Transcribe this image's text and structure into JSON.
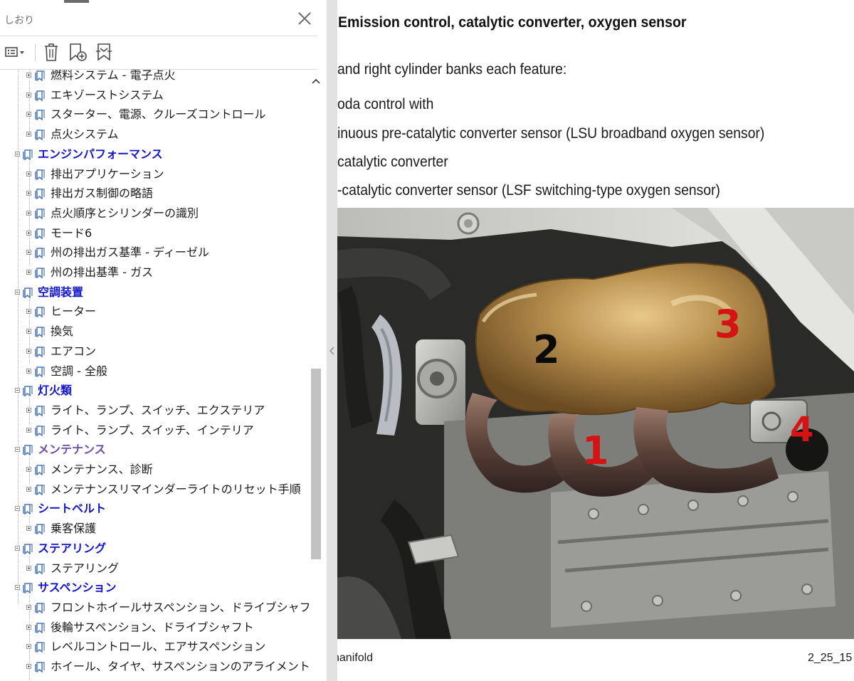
{
  "panel": {
    "title": "しおり",
    "close_icon": "close-icon",
    "toolbar": [
      {
        "name": "options-menu",
        "icon": "list-options-icon"
      },
      {
        "name": "delete-bookmark",
        "icon": "trash-icon"
      },
      {
        "name": "new-bookmark",
        "icon": "add-bookmark-icon"
      },
      {
        "name": "expand-bookmark",
        "icon": "expand-bookmark-icon"
      }
    ]
  },
  "bookmarks": [
    {
      "label": "燃料システム - 電子点火",
      "level": 2
    },
    {
      "label": "エキゾーストシステム",
      "level": 2
    },
    {
      "label": "スターター、電源、クルーズコントロール",
      "level": 2
    },
    {
      "label": "点火システム",
      "level": 2
    },
    {
      "label": "エンジンパフォーマンス",
      "level": 1
    },
    {
      "label": "排出アプリケーション",
      "level": 2
    },
    {
      "label": "排出ガス制御の略語",
      "level": 2
    },
    {
      "label": "点火順序とシリンダーの識別",
      "level": 2
    },
    {
      "label": "モード6",
      "level": 2
    },
    {
      "label": "州の排出ガス基準 - ディーゼル",
      "level": 2
    },
    {
      "label": "州の排出基準 - ガス",
      "level": 2
    },
    {
      "label": "空調装置",
      "level": 1
    },
    {
      "label": "ヒーター",
      "level": 2
    },
    {
      "label": "換気",
      "level": 2
    },
    {
      "label": "エアコン",
      "level": 2
    },
    {
      "label": "空調 - 全般",
      "level": 2
    },
    {
      "label": "灯火類",
      "level": 1
    },
    {
      "label": "ライト、ランプ、スイッチ、エクステリア",
      "level": 2
    },
    {
      "label": "ライト、ランプ、スイッチ、インテリア",
      "level": 2
    },
    {
      "label": "メンテナンス",
      "level": 1,
      "visited": true
    },
    {
      "label": "メンテナンス、診断",
      "level": 2
    },
    {
      "label": "メンテナンスリマインダーライトのリセット手順",
      "level": 2
    },
    {
      "label": "シートベルト",
      "level": 1
    },
    {
      "label": "乗客保護",
      "level": 2
    },
    {
      "label": "ステアリング",
      "level": 1
    },
    {
      "label": "ステアリング",
      "level": 2
    },
    {
      "label": "サスペンション",
      "level": 1
    },
    {
      "label": "フロントホイールサスペンション、ドライブシャフト",
      "level": 2
    },
    {
      "label": "後輪サスペンション、ドライブシャフト",
      "level": 2
    },
    {
      "label": "レベルコントロール、エアサスペンション",
      "level": 2
    },
    {
      "label": "ホイール、タイヤ、サスペンションのアライメント",
      "level": 2
    }
  ],
  "document": {
    "title": "Emission control, catalytic converter, oxygen sensor",
    "lines": [
      "and right cylinder banks each feature:",
      "oda control with",
      "inuous pre-catalytic converter sensor (LSU broadband oxygen sensor)",
      "catalytic converter",
      "-catalytic converter sensor (LSF switching-type oxygen sensor)"
    ],
    "photo_labels": [
      "1",
      "2",
      "3",
      "4"
    ],
    "caption": "nanifold",
    "figure_id": "2_25_15"
  },
  "colors": {
    "parent_link": "#1515c8",
    "visited_link": "#6a4fa3",
    "photo_label_red": "#d41414",
    "photo_label_black": "#0a0a0a"
  }
}
